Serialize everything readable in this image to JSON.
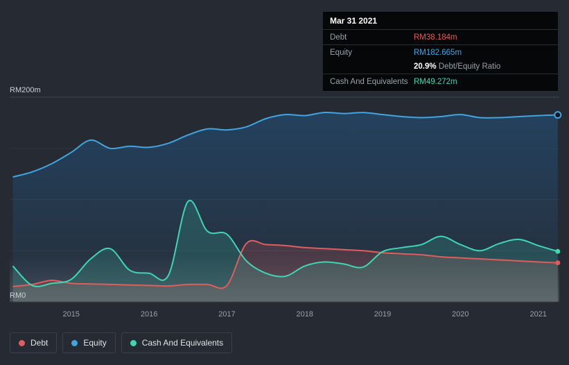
{
  "page": {
    "background": "#262b33"
  },
  "y_axis": {
    "top_label": "RM200m",
    "bottom_label": "RM0"
  },
  "x_axis": {
    "ticks": [
      "2015",
      "2016",
      "2017",
      "2018",
      "2019",
      "2020",
      "2021"
    ]
  },
  "tooltip": {
    "date": "Mar 31 2021",
    "debt_label": "Debt",
    "debt_value": "RM38.184m",
    "equity_label": "Equity",
    "equity_value": "RM182.665m",
    "ratio_value": "20.9%",
    "ratio_suffix": "Debt/Equity Ratio",
    "cash_label": "Cash And Equivalents",
    "cash_value": "RM49.272m"
  },
  "legend": {
    "items": [
      {
        "label": "Debt",
        "color": "#e15d5d"
      },
      {
        "label": "Equity",
        "color": "#41a5e1"
      },
      {
        "label": "Cash And Equivalents",
        "color": "#3fd6b5"
      }
    ]
  },
  "chart_data": {
    "type": "area",
    "title": "",
    "x": [
      2014.25,
      2014.5,
      2014.75,
      2015,
      2015.25,
      2015.5,
      2015.75,
      2016,
      2016.25,
      2016.5,
      2016.75,
      2017,
      2017.25,
      2017.5,
      2017.75,
      2018,
      2018.25,
      2018.5,
      2018.75,
      2019,
      2019.25,
      2019.5,
      2019.75,
      2020,
      2020.25,
      2020.5,
      2020.75,
      2021,
      2021.25
    ],
    "series": [
      {
        "name": "Debt",
        "color": "#e15d5d",
        "values": [
          15,
          17,
          21,
          18,
          17.5,
          17,
          16.5,
          16,
          15.5,
          17,
          17,
          16,
          57,
          56,
          55,
          53,
          52,
          51,
          50,
          48,
          47,
          46,
          44,
          43,
          42,
          41,
          40,
          39,
          38.184
        ]
      },
      {
        "name": "Equity",
        "color": "#41a5e1",
        "values": [
          122,
          127,
          135,
          146,
          158,
          150,
          152,
          151,
          155,
          163,
          169,
          168,
          171,
          179,
          183,
          182,
          185,
          184,
          185,
          183,
          181,
          180,
          181,
          183,
          180,
          180,
          181,
          182,
          182.665
        ]
      },
      {
        "name": "Cash And Equivalents",
        "color": "#3fd6b5",
        "values": [
          35,
          16,
          18,
          22,
          42,
          52,
          31,
          28,
          26,
          98,
          69,
          66,
          40,
          28,
          25,
          35,
          39,
          37,
          34,
          49,
          53,
          56,
          64,
          56,
          50,
          57,
          61,
          55,
          49.272
        ]
      }
    ],
    "xlim": [
      2014.21,
      2021.27
    ],
    "ylim": [
      0,
      200
    ],
    "x_ticks": [
      2015,
      2016,
      2017,
      2018,
      2019,
      2020,
      2021
    ],
    "y_tick_labels": {
      "top": "RM200m",
      "bottom": "RM0"
    },
    "legend_position": "bottom-left",
    "grid": true
  }
}
